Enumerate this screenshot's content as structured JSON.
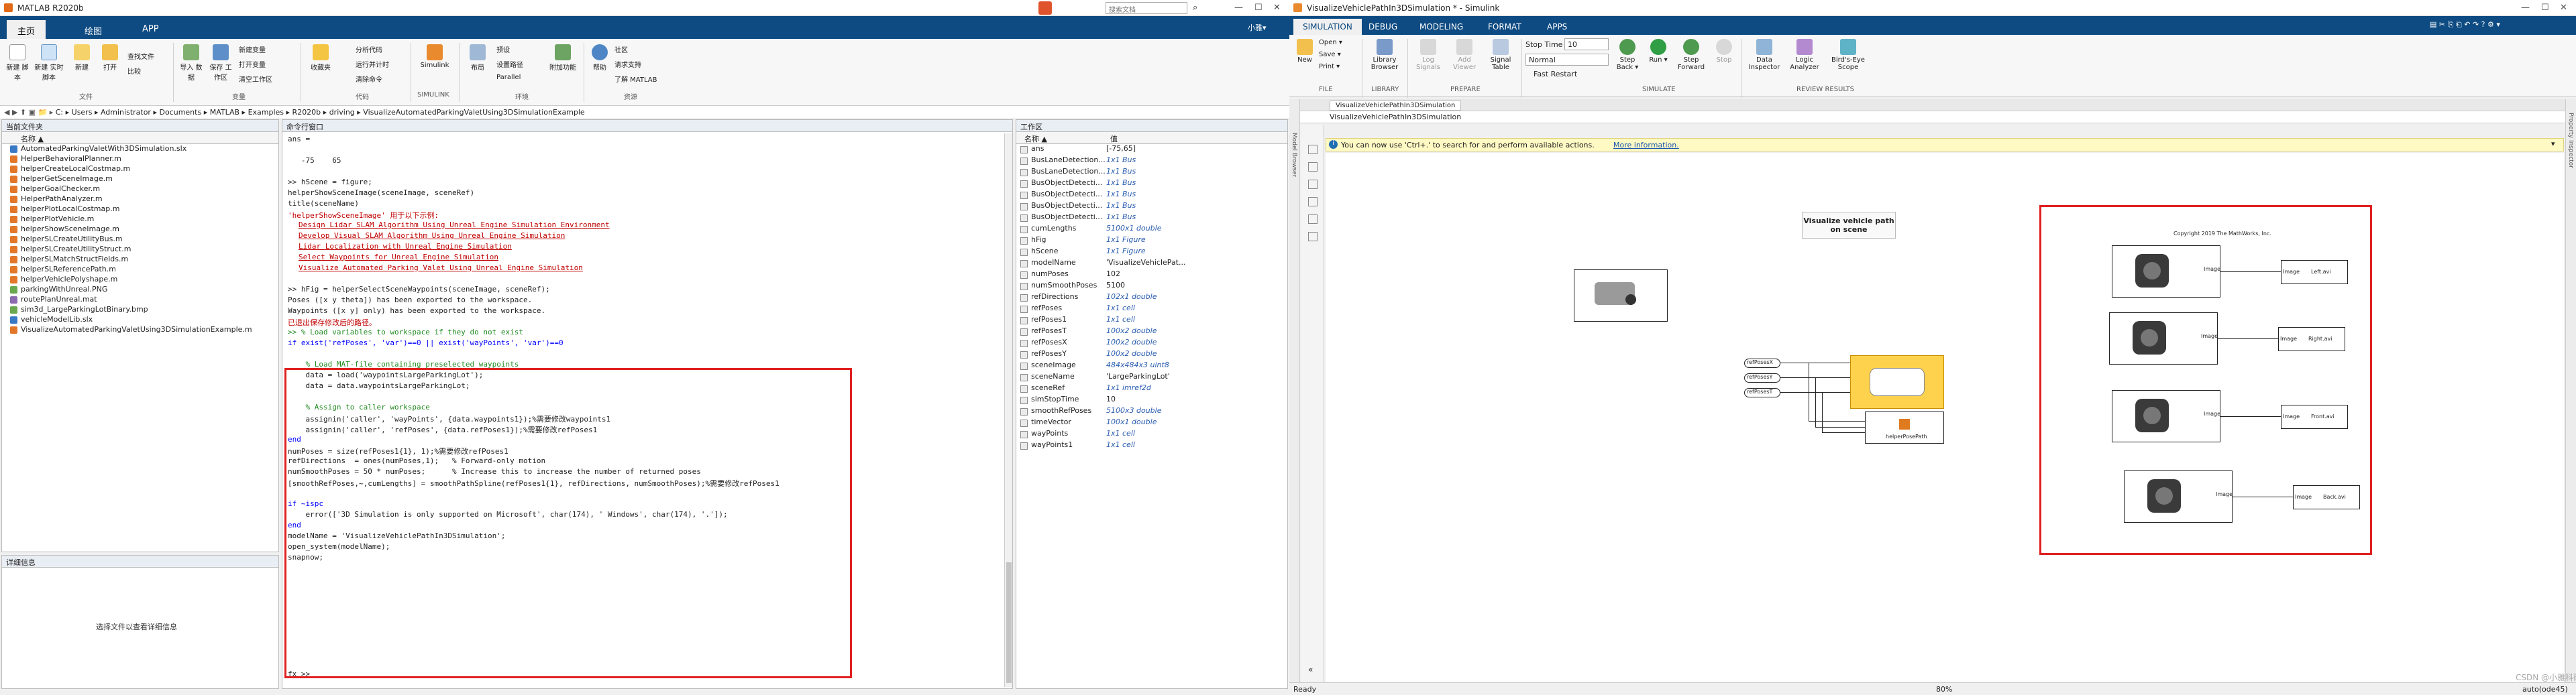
{
  "matlab": {
    "window_title": "MATLAB R2020b",
    "tabs": [
      "主页",
      "绘图",
      "APP"
    ],
    "search_placeholder": "搜索文档",
    "user": "小雅▾",
    "toolbar": {
      "buttons": [
        "新建\n脚本",
        "新建\n实时脚本",
        "新建",
        "打开",
        "查找文件",
        "比较",
        "导入\n数据",
        "保存\n工作区",
        "新建变量",
        "打开变量",
        "清空工作区",
        "收藏夹",
        "分析代码",
        "运行并计时",
        "清除命令",
        "Simulink",
        "布局",
        "预设",
        "设置路径",
        "Parallel",
        "附加功能",
        "帮助",
        "社区",
        "请求支持",
        "了解 MATLAB"
      ],
      "groups": [
        "文件",
        "变量",
        "代码",
        "SIMULINK",
        "环境",
        "资源"
      ]
    },
    "address": {
      "path": [
        "C:",
        "Users",
        "Administrator",
        "Documents",
        "MATLAB",
        "Examples",
        "R2020b",
        "driving",
        "VisualizeAutomatedParkingValetUsing3DSimulationExample"
      ]
    },
    "current_folder": {
      "title": "当前文件夹",
      "column": "名称 ▲",
      "files": [
        "AutomatedParkingValetWith3DSimulation.slx",
        "HelperBehavioralPlanner.m",
        "helperCreateLocalCostmap.m",
        "helperGetSceneImage.m",
        "helperGoalChecker.m",
        "HelperPathAnalyzer.m",
        "helperPlotLocalCostmap.m",
        "helperPlotVehicle.m",
        "helperShowSceneImage.m",
        "helperSLCreateUtilityBus.m",
        "helperSLCreateUtilityStruct.m",
        "helperSLMatchStructFields.m",
        "helperSLReferencePath.m",
        "helperVehiclePolyshape.m",
        "parkingWithUnreal.PNG",
        "routePlanUnreal.mat",
        "sim3d_LargeParkingLotBinary.bmp",
        "vehicleModelLib.slx",
        "VisualizeAutomatedParkingValetUsing3DSimulationExample.m"
      ]
    },
    "details": {
      "title": "详细信息",
      "empty_text": "选择文件以查看详细信息"
    },
    "command_window": {
      "title": "命令行窗口",
      "lines": [
        {
          "t": "ans =",
          "cls": ""
        },
        {
          "t": "",
          "cls": ""
        },
        {
          "t": "   -75    65",
          "cls": ""
        },
        {
          "t": "",
          "cls": ""
        },
        {
          "t": ">> hScene = figure;",
          "cls": ""
        },
        {
          "t": "helperShowSceneImage(sceneImage, sceneRef)",
          "cls": ""
        },
        {
          "t": "title(sceneName)",
          "cls": ""
        },
        {
          "t": "'helperShowSceneImage' 用于以下示例:",
          "cls": "red"
        },
        {
          "t": "Design Lidar SLAM Algorithm Using Unreal Engine Simulation Environment",
          "cls": "link"
        },
        {
          "t": "Develop Visual SLAM Algorithm Using Unreal Engine Simulation",
          "cls": "link"
        },
        {
          "t": "Lidar Localization with Unreal Engine Simulation",
          "cls": "link"
        },
        {
          "t": "Select Waypoints for Unreal Engine Simulation",
          "cls": "link"
        },
        {
          "t": "Visualize Automated Parking Valet Using Unreal Engine Simulation",
          "cls": "link"
        },
        {
          "t": "",
          "cls": ""
        },
        {
          "t": ">> hFig = helperSelectSceneWaypoints(sceneImage, sceneRef);",
          "cls": ""
        },
        {
          "t": "Poses ([x y theta]) has been exported to the workspace.",
          "cls": ""
        },
        {
          "t": "Waypoints ([x y] only) has been exported to the workspace.",
          "cls": ""
        },
        {
          "t": "已退出保存修改后的路径。",
          "cls": "red"
        },
        {
          "t": ">> % Load variables to workspace if they do not exist",
          "cls": "c"
        },
        {
          "t": "if exist('refPoses', 'var')==0 || exist('wayPoints', 'var')==0",
          "cls": "k"
        },
        {
          "t": "",
          "cls": ""
        },
        {
          "t": "    % Load MAT-file containing preselected waypoints",
          "cls": "c"
        },
        {
          "t": "    data = load('waypointsLargeParkingLot');",
          "cls": ""
        },
        {
          "t": "    data = data.waypointsLargeParkingLot;",
          "cls": ""
        },
        {
          "t": "",
          "cls": ""
        },
        {
          "t": "    % Assign to caller workspace",
          "cls": "c"
        },
        {
          "t": "    assignin('caller', 'wayPoints', {data.waypoints1});%需要修改waypoints1",
          "cls": ""
        },
        {
          "t": "    assignin('caller', 'refPoses', {data.refPoses1});%需要修改refPoses1",
          "cls": ""
        },
        {
          "t": "end",
          "cls": "k"
        },
        {
          "t": "numPoses = size(refPoses1{1}, 1);%需要修改refPoses1",
          "cls": ""
        },
        {
          "t": "refDirections  = ones(numPoses,1);   % Forward-only motion",
          "cls": ""
        },
        {
          "t": "numSmoothPoses = 50 * numPoses;      % Increase this to increase the number of returned poses",
          "cls": ""
        },
        {
          "t": "[smoothRefPoses,~,cumLengths] = smoothPathSpline(refPoses1{1}, refDirections, numSmoothPoses);%需要修改refPoses1",
          "cls": ""
        },
        {
          "t": "",
          "cls": ""
        },
        {
          "t": "if ~ispc",
          "cls": "k"
        },
        {
          "t": "    error(['3D Simulation is only supported on Microsoft', char(174), ' Windows', char(174), '.']);",
          "cls": ""
        },
        {
          "t": "end",
          "cls": "k"
        },
        {
          "t": "modelName = 'VisualizeVehiclePathIn3DSimulation';",
          "cls": ""
        },
        {
          "t": "open_system(modelName);",
          "cls": ""
        },
        {
          "t": "snapnow;",
          "cls": ""
        }
      ],
      "prompt": "fx >>"
    },
    "workspace": {
      "title": "工作区",
      "col_name": "名称 ▲",
      "col_value": "值",
      "vars": [
        {
          "n": "ans",
          "v": "[-75,65]",
          "i": false
        },
        {
          "n": "BusLaneDetection...",
          "v": "1x1 Bus",
          "i": true
        },
        {
          "n": "BusLaneDetection...",
          "v": "1x1 Bus",
          "i": true
        },
        {
          "n": "BusObjectDetecti...",
          "v": "1x1 Bus",
          "i": true
        },
        {
          "n": "BusObjectDetecti...",
          "v": "1x1 Bus",
          "i": true
        },
        {
          "n": "BusObjectDetecti...",
          "v": "1x1 Bus",
          "i": true
        },
        {
          "n": "BusObjectDetecti...",
          "v": "1x1 Bus",
          "i": true
        },
        {
          "n": "cumLengths",
          "v": "5100x1 double",
          "i": true
        },
        {
          "n": "hFig",
          "v": "1x1 Figure",
          "i": true
        },
        {
          "n": "hScene",
          "v": "1x1 Figure",
          "i": true
        },
        {
          "n": "modelName",
          "v": "'VisualizeVehiclePat...",
          "i": false
        },
        {
          "n": "numPoses",
          "v": "102",
          "i": false
        },
        {
          "n": "numSmoothPoses",
          "v": "5100",
          "i": false
        },
        {
          "n": "refDirections",
          "v": "102x1 double",
          "i": true
        },
        {
          "n": "refPoses",
          "v": "1x1 cell",
          "i": true
        },
        {
          "n": "refPoses1",
          "v": "1x1 cell",
          "i": true
        },
        {
          "n": "refPosesT",
          "v": "100x2 double",
          "i": true
        },
        {
          "n": "refPosesX",
          "v": "100x2 double",
          "i": true
        },
        {
          "n": "refPosesY",
          "v": "100x2 double",
          "i": true
        },
        {
          "n": "sceneImage",
          "v": "484x484x3 uint8",
          "i": true
        },
        {
          "n": "sceneName",
          "v": "'LargeParkingLot'",
          "i": false
        },
        {
          "n": "sceneRef",
          "v": "1x1 imref2d",
          "i": true
        },
        {
          "n": "simStopTime",
          "v": "10",
          "i": false
        },
        {
          "n": "smoothRefPoses",
          "v": "5100x3 double",
          "i": true
        },
        {
          "n": "timeVector",
          "v": "100x1 double",
          "i": true
        },
        {
          "n": "wayPoints",
          "v": "1x1 cell",
          "i": true
        },
        {
          "n": "wayPoints1",
          "v": "1x1 cell",
          "i": true
        }
      ]
    }
  },
  "simulink": {
    "window_title": "VisualizeVehiclePathIn3DSimulation * - Simulink",
    "tabs": [
      "SIMULATION",
      "DEBUG",
      "MODELING",
      "FORMAT",
      "APPS"
    ],
    "toolbar": {
      "new": "New",
      "open": "Open ▾",
      "save": "Save ▾",
      "print": "Print ▾",
      "library": "Library\nBrowser",
      "log_signals": "Log\nSignals",
      "add_viewer": "Add\nViewer",
      "signal_table": "Signal\nTable",
      "stop_time_label": "Stop Time",
      "stop_time": "10",
      "mode": "Normal",
      "fast_restart": "Fast Restart",
      "step_back": "Step\nBack ▾",
      "run": "Run\n▾",
      "step_forward": "Step\nForward",
      "stop": "Stop",
      "data_inspector": "Data\nInspector",
      "logic_analyzer": "Logic\nAnalyzer",
      "birds_eye": "Bird's-Eye\nScope",
      "sections": [
        "FILE",
        "LIBRARY",
        "PREPARE",
        "SIMULATE",
        "REVIEW RESULTS"
      ]
    },
    "model_tab": "VisualizeVehiclePathIn3DSimulation",
    "breadcrumb": "VisualizeVehiclePathIn3DSimulation",
    "model_browser": "Model Browser",
    "property_inspector": "Property Inspector",
    "info_bar": {
      "text": "You can now use 'Ctrl+.' to search for and perform available actions.",
      "link": "More information."
    },
    "canvas": {
      "annotation": "Visualize vehicle path on scene",
      "copyright": "Copyright 2019 The MathWorks, Inc.",
      "inports": [
        "refPosesX",
        "refPosesY",
        "refPosesT"
      ],
      "subsystem_label": "helperPosePath",
      "cameras": [
        {
          "in": "Image",
          "out": "Left.avi"
        },
        {
          "in": "Image",
          "out": "Right.avi"
        },
        {
          "in": "Image",
          "out": "Front.avi"
        },
        {
          "in": "Image",
          "out": "Back.avi"
        }
      ]
    },
    "status": {
      "left": "Ready",
      "zoom": "80%",
      "solver": "auto(ode45)"
    },
    "watermark": "CSDN @小雅科研"
  }
}
